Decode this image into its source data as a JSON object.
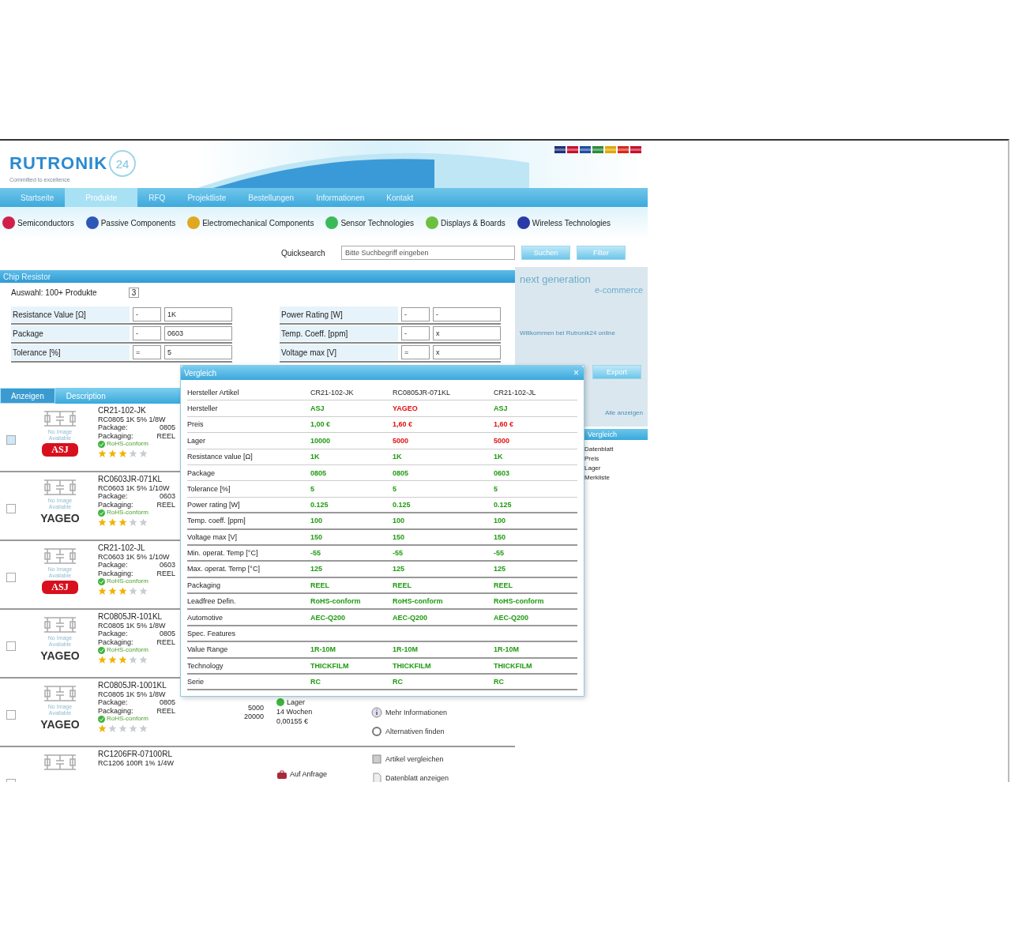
{
  "header": {
    "logo": "RUTRONIK",
    "logo_badge": "24",
    "tagline": "Committed to excellence"
  },
  "nav": [
    {
      "label": "Startseite",
      "selected": false
    },
    {
      "label": "Produkte",
      "selected": true
    },
    {
      "label": "RFQ",
      "selected": false
    },
    {
      "label": "Projektliste",
      "selected": false
    },
    {
      "label": "Bestellungen",
      "selected": false
    },
    {
      "label": "Informationen",
      "selected": false
    },
    {
      "label": "Kontakt",
      "selected": false
    }
  ],
  "categories": [
    {
      "label": "Semiconductors",
      "color": "#d0204a"
    },
    {
      "label": "Passive Components",
      "color": "#2e58b8"
    },
    {
      "label": "Electromechanical Components",
      "color": "#e0a820"
    },
    {
      "label": "Sensor Technologies",
      "color": "#3cba5a"
    },
    {
      "label": "Displays & Boards",
      "color": "#6cc040"
    },
    {
      "label": "Wireless Technologies",
      "color": "#2a3aa8"
    }
  ],
  "search": {
    "label": "Quicksearch",
    "value": "Bitte Suchbegriff eingeben",
    "buttons": [
      "Suchen",
      "Filter"
    ]
  },
  "filter": {
    "title": "Chip Resistor",
    "count_label": "Auswahl: 100+ Produkte",
    "count_value": "3",
    "left": [
      {
        "label": "Resistance Value [Ω]",
        "op": "-",
        "value": "1K"
      },
      {
        "label": "Package",
        "op": "-",
        "value": "0603"
      },
      {
        "label": "Tolerance [%]",
        "op": "=",
        "value": "5"
      }
    ],
    "right": [
      {
        "label": "Power Rating [W]",
        "op": "-",
        "value": "-"
      },
      {
        "label": "Temp. Coeff. [ppm]",
        "op": "-",
        "value": "x"
      },
      {
        "label": "Voltage max [V]",
        "op": "=",
        "value": "x"
      }
    ]
  },
  "promo": {
    "title": "next generation",
    "subtitle": "e-commerce",
    "text": "Willkommen bei Rutronik24 online",
    "button": "Export",
    "link": "Alle anzeigen",
    "list_title": "Vergleich",
    "list": [
      "Datenblatt",
      "Preis",
      "Lager",
      "Merkliste"
    ]
  },
  "results": {
    "tabs": [
      {
        "label": "Anzeigen",
        "selected": true
      },
      {
        "label": "Description",
        "selected": false
      }
    ],
    "rows": [
      {
        "checked": true,
        "image_label": "No Image Available",
        "brand": "ASJ",
        "kind": "asj",
        "part": "CR21-102-JK",
        "desc": "RC0805 1K 5% 1/8W",
        "package_label": "Package:",
        "package": "0805",
        "packaging_label": "Packaging:",
        "packaging": "REEL",
        "rohs": "RoHS-conform",
        "stars": 3
      },
      {
        "checked": false,
        "image_label": "No Image Available",
        "brand": "YAGEO",
        "kind": "yageo",
        "part": "RC0603JR-071KL",
        "desc": "RC0603 1K 5% 1/10W",
        "package_label": "Package:",
        "package": "0603",
        "packaging_label": "Packaging:",
        "packaging": "REEL",
        "rohs": "RoHS-conform",
        "stars": 3
      },
      {
        "checked": false,
        "image_label": "No Image Available",
        "brand": "ASJ",
        "kind": "asj",
        "part": "CR21-102-JL",
        "desc": "RC0603 1K 5% 1/10W",
        "package_label": "Package:",
        "package": "0603",
        "packaging_label": "Packaging:",
        "packaging": "REEL",
        "rohs": "RoHS-conform",
        "stars": 3
      },
      {
        "checked": false,
        "image_label": "No Image Available",
        "brand": "YAGEO",
        "kind": "yageo",
        "part": "RC0805JR-101KL",
        "desc": "RC0805 1K 5% 1/8W",
        "package_label": "Package:",
        "package": "0805",
        "packaging_label": "Packaging:",
        "packaging": "REEL",
        "rohs": "RoHS-conform",
        "stars": 3
      },
      {
        "checked": false,
        "image_label": "No Image Available",
        "brand": "YAGEO",
        "kind": "yageo",
        "part": "RC0805JR-1001KL",
        "desc": "RC0805 1K 5% 1/8W",
        "package_label": "Package:",
        "package": "0805",
        "packaging_label": "Packaging:",
        "packaging": "REEL",
        "rohs": "RoHS-conform",
        "stars": 1,
        "qty": [
          "5000",
          "20000"
        ],
        "in_stock": true,
        "stock": [
          "Lager",
          "14 Wochen",
          "0,00155 €"
        ],
        "actions": [
          {
            "kind": "info",
            "label": "Mehr Informationen"
          },
          {
            "kind": "alt",
            "label": "Alternativen finden"
          }
        ]
      },
      {
        "checked": false,
        "part": "RC1206FR-07100RL",
        "desc": "RC1206 100R 1% 1/4W",
        "in_stock": false,
        "stock": [
          "Auf Anfrage"
        ],
        "actions": [
          {
            "kind": "compare",
            "label": "Artikel vergleichen"
          },
          {
            "kind": "sheet",
            "label": "Datenblatt anzeigen"
          }
        ]
      }
    ]
  },
  "compare": {
    "title": "Vergleich",
    "close": "×",
    "rows": [
      {
        "label": "Hersteller Artikel",
        "values": [
          {
            "text": "CR21-102-JK",
            "kind": "plain"
          },
          {
            "text": "RC0805JR-071KL",
            "kind": "plain"
          },
          {
            "text": "CR21-102-JL",
            "kind": "plain"
          }
        ]
      },
      {
        "label": "Hersteller",
        "values": [
          {
            "text": "ASJ",
            "kind": "good"
          },
          {
            "text": "YAGEO",
            "kind": "bad"
          },
          {
            "text": "ASJ",
            "kind": "good"
          }
        ]
      },
      {
        "label": "Preis",
        "values": [
          {
            "text": "1,00 €",
            "kind": "good"
          },
          {
            "text": "1,60 €",
            "kind": "bad"
          },
          {
            "text": "1,60 €",
            "kind": "bad"
          }
        ]
      },
      {
        "label": "Lager",
        "values": [
          {
            "text": "10000",
            "kind": "good"
          },
          {
            "text": "5000",
            "kind": "bad"
          },
          {
            "text": "5000",
            "kind": "bad"
          }
        ]
      },
      {
        "label": "Resistance value [Ω]",
        "values": [
          {
            "text": "1K",
            "kind": "good"
          },
          {
            "text": "1K",
            "kind": "good"
          },
          {
            "text": "1K",
            "kind": "good"
          }
        ]
      },
      {
        "label": "Package",
        "values": [
          {
            "text": "0805",
            "kind": "good"
          },
          {
            "text": "0805",
            "kind": "good"
          },
          {
            "text": "0603",
            "kind": "good"
          }
        ]
      },
      {
        "label": "Tolerance [%]",
        "values": [
          {
            "text": "5",
            "kind": "good"
          },
          {
            "text": "5",
            "kind": "good"
          },
          {
            "text": "5",
            "kind": "good"
          }
        ]
      },
      {
        "label": "Power rating [W]",
        "values": [
          {
            "text": "0.125",
            "kind": "good"
          },
          {
            "text": "0.125",
            "kind": "good"
          },
          {
            "text": "0.125",
            "kind": "good"
          }
        ]
      },
      {
        "label": "Temp. coeff. [ppm]",
        "values": [
          {
            "text": "100",
            "kind": "good"
          },
          {
            "text": "100",
            "kind": "good"
          },
          {
            "text": "100",
            "kind": "good"
          }
        ]
      },
      {
        "label": "Voltage max [V]",
        "values": [
          {
            "text": "150",
            "kind": "good"
          },
          {
            "text": "150",
            "kind": "good"
          },
          {
            "text": "150",
            "kind": "good"
          }
        ]
      },
      {
        "label": "Min. operat. Temp [°C]",
        "values": [
          {
            "text": "-55",
            "kind": "good"
          },
          {
            "text": "-55",
            "kind": "good"
          },
          {
            "text": "-55",
            "kind": "good"
          }
        ]
      },
      {
        "label": "Max. operat. Temp [°C]",
        "values": [
          {
            "text": "125",
            "kind": "good"
          },
          {
            "text": "125",
            "kind": "good"
          },
          {
            "text": "125",
            "kind": "good"
          }
        ]
      },
      {
        "label": "Packaging",
        "values": [
          {
            "text": "REEL",
            "kind": "good"
          },
          {
            "text": "REEL",
            "kind": "good"
          },
          {
            "text": "REEL",
            "kind": "good"
          }
        ]
      },
      {
        "label": "Leadfree Defin.",
        "values": [
          {
            "text": "RoHS-conform",
            "kind": "good"
          },
          {
            "text": "RoHS-conform",
            "kind": "good"
          },
          {
            "text": "RoHS-conform",
            "kind": "good"
          }
        ]
      },
      {
        "label": "Automotive",
        "values": [
          {
            "text": "AEC-Q200",
            "kind": "good"
          },
          {
            "text": "AEC-Q200",
            "kind": "good"
          },
          {
            "text": "AEC-Q200",
            "kind": "good"
          }
        ]
      },
      {
        "label": "Spec. Features"
      },
      {
        "label": "Value Range",
        "values": [
          {
            "text": "1R-10M",
            "kind": "good"
          },
          {
            "text": "1R-10M",
            "kind": "good"
          },
          {
            "text": "1R-10M",
            "kind": "good"
          }
        ]
      },
      {
        "label": "Technology",
        "values": [
          {
            "text": "THICKFILM",
            "kind": "good"
          },
          {
            "text": "THICKFILM",
            "kind": "good"
          },
          {
            "text": "THICKFILM",
            "kind": "good"
          }
        ]
      },
      {
        "label": "Serie",
        "values": [
          {
            "text": "RC",
            "kind": "good"
          },
          {
            "text": "RC",
            "kind": "good"
          },
          {
            "text": "RC",
            "kind": "good"
          }
        ]
      }
    ]
  }
}
